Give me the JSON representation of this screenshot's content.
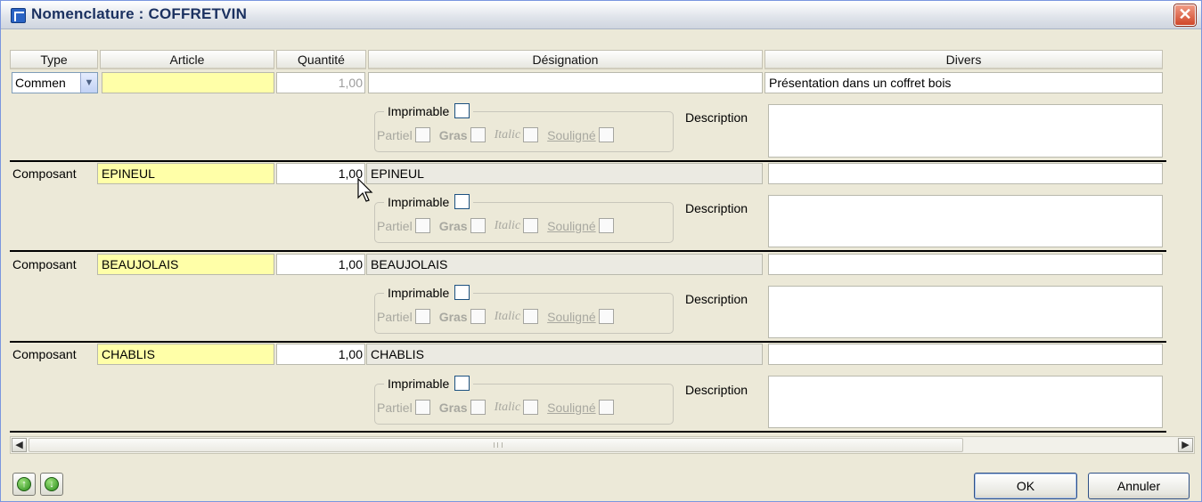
{
  "window": {
    "title": "Nomenclature : COFFRETVIN",
    "close_symbol": "✕"
  },
  "columns": {
    "type": "Type",
    "article": "Article",
    "quantite": "Quantité",
    "designation": "Désignation",
    "divers": "Divers"
  },
  "options": {
    "imprimable": "Imprimable",
    "partiel": "Partiel",
    "gras": "Gras",
    "italic": "Italic",
    "souligne": "Souligné",
    "description": "Description"
  },
  "rows": [
    {
      "type": "Commen",
      "type_is_select": true,
      "article": "",
      "quantite": "1,00",
      "quantite_muted": true,
      "designation": "",
      "divers": "Présentation dans un coffret bois"
    },
    {
      "type": "Composant",
      "article": "EPINEUL",
      "quantite": "1,00",
      "designation": "EPINEUL",
      "divers": ""
    },
    {
      "type": "Composant",
      "article": "BEAUJOLAIS",
      "quantite": "1,00",
      "designation": "BEAUJOLAIS",
      "divers": ""
    },
    {
      "type": "Composant",
      "article": "CHABLIS",
      "quantite": "1,00",
      "designation": "CHABLIS",
      "divers": ""
    }
  ],
  "footer": {
    "ok_label": "OK",
    "cancel_label": "Annuler",
    "move_up_icon": "arrow-up",
    "move_down_icon": "arrow-down"
  }
}
